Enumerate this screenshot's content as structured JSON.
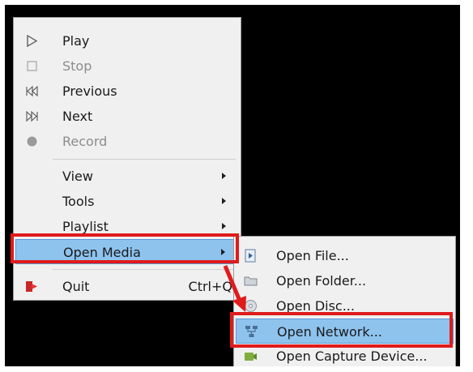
{
  "main_menu": {
    "items": [
      {
        "label": "Play",
        "icon": "play-icon",
        "enabled": true
      },
      {
        "label": "Stop",
        "icon": "stop-icon",
        "enabled": false
      },
      {
        "label": "Previous",
        "icon": "previous-icon",
        "enabled": true
      },
      {
        "label": "Next",
        "icon": "next-icon",
        "enabled": true
      },
      {
        "label": "Record",
        "icon": "record-icon",
        "enabled": false
      },
      {
        "label": "View",
        "submenu": true
      },
      {
        "label": "Tools",
        "submenu": true
      },
      {
        "label": "Playlist",
        "submenu": true
      },
      {
        "label": "Open Media",
        "submenu": true,
        "highlighted": true
      },
      {
        "label": "Quit",
        "icon": "quit-icon",
        "shortcut": "Ctrl+Q"
      }
    ]
  },
  "open_media_submenu": {
    "items": [
      {
        "label": "Open File...",
        "icon": "file-icon"
      },
      {
        "label": "Open Folder...",
        "icon": "folder-icon"
      },
      {
        "label": "Open Disc...",
        "icon": "disc-icon"
      },
      {
        "label": "Open Network...",
        "icon": "network-icon",
        "highlighted": true
      },
      {
        "label": "Open Capture Device...",
        "icon": "capture-device-icon"
      }
    ]
  },
  "colors": {
    "highlight": "#8ec3ee",
    "annotation_red": "#e01b1b",
    "background": "#000000"
  }
}
